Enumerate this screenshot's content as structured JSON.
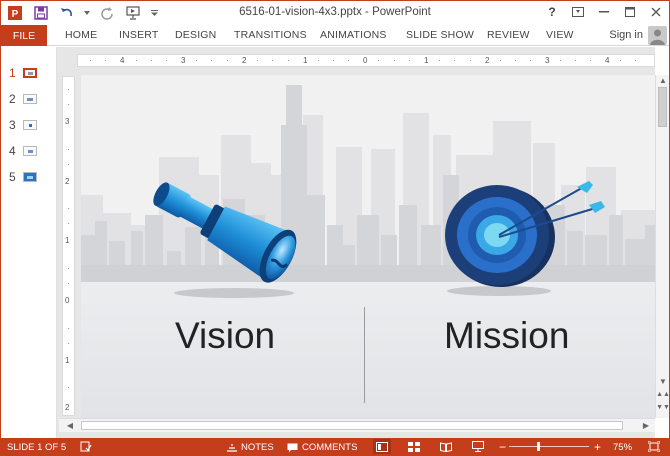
{
  "window": {
    "title": "6516-01-vision-4x3.pptx - PowerPoint",
    "help_label": "?",
    "signin_label": "Sign in"
  },
  "ribbon": {
    "file_label": "FILE",
    "tabs": [
      "HOME",
      "INSERT",
      "DESIGN",
      "TRANSITIONS",
      "ANIMATIONS",
      "SLIDE SHOW",
      "REVIEW",
      "VIEW"
    ]
  },
  "thumbnails": [
    {
      "number": "1",
      "selected": true
    },
    {
      "number": "2",
      "selected": false
    },
    {
      "number": "3",
      "selected": false
    },
    {
      "number": "4",
      "selected": false
    },
    {
      "number": "5",
      "selected": false
    }
  ],
  "ruler": {
    "horizontal": [
      "4",
      "3",
      "2",
      "1",
      "0",
      "1",
      "2",
      "3",
      "4"
    ],
    "vertical": [
      "3",
      "2",
      "1",
      "0",
      "1",
      "2"
    ]
  },
  "slide": {
    "vision_text": "Vision",
    "mission_text": "Mission"
  },
  "statusbar": {
    "slide_info": "SLIDE 1 OF 5",
    "notes_label": "NOTES",
    "comments_label": "COMMENTS",
    "zoom_minus": "−",
    "zoom_plus": "+",
    "zoom_level": "75%"
  },
  "colors": {
    "accent": "#c43e1c",
    "telescope": "#1f8fd8",
    "target_dark": "#1c3f7a",
    "target_mid": "#2a6fc9",
    "target_center": "#7dd8f2"
  }
}
